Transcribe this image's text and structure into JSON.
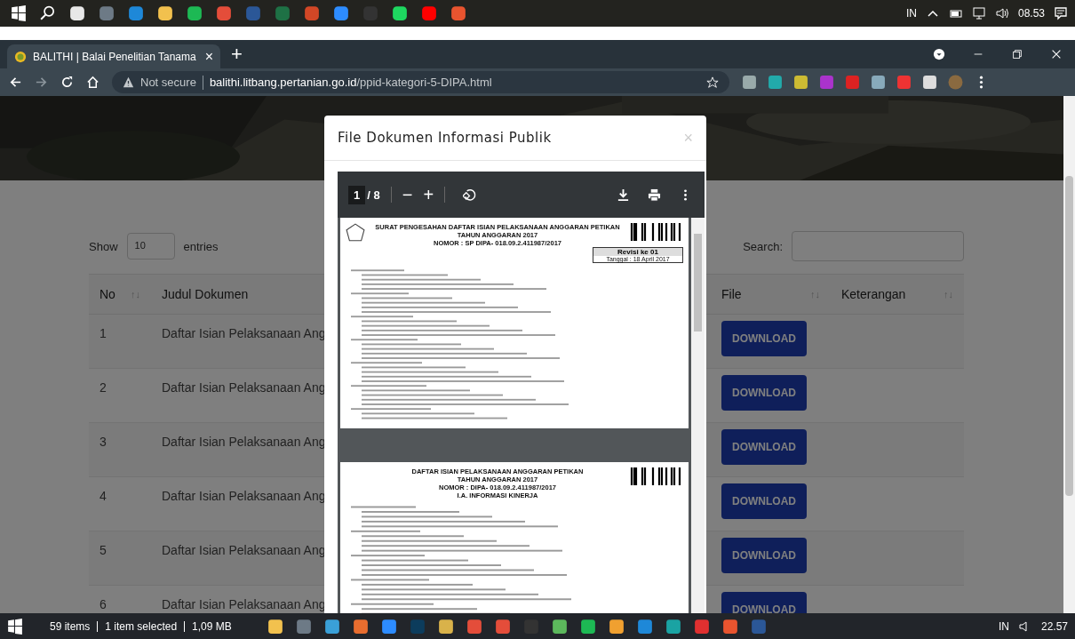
{
  "taskbar_top": {
    "language": "IN",
    "time": "08.53"
  },
  "browser": {
    "tab": {
      "title": "BALITHI | Balai Penelitian Tanama",
      "close": "×",
      "selected": true
    },
    "new_tab": "+",
    "address": {
      "security": "Not secure",
      "domain": "balithi.litbang.pertanian.go.id",
      "path": "/ppid-kategori-5-DIPA.html"
    }
  },
  "page": {
    "show_label": "Show",
    "page_size": "10",
    "entries_label": "entries",
    "search_label": "Search:",
    "columns": [
      {
        "label": "No",
        "sort": "↑↓",
        "kind": "no"
      },
      {
        "label": "Judul Dokumen",
        "kind": "title"
      },
      {
        "label": "File",
        "sort": "↑↓",
        "kind": "file"
      },
      {
        "label": "Keterangan",
        "sort": "↑↓",
        "kind": "note"
      }
    ],
    "rows": [
      {
        "no": "1",
        "title": "Daftar Isian Pelaksanaan Ang",
        "button": "DOWNLOAD"
      },
      {
        "no": "2",
        "title": "Daftar Isian Pelaksanaan Ang",
        "button": "DOWNLOAD"
      },
      {
        "no": "3",
        "title": "Daftar Isian Pelaksanaan Ang",
        "button": "DOWNLOAD"
      },
      {
        "no": "4",
        "title": "Daftar Isian Pelaksanaan Ang",
        "button": "DOWNLOAD"
      },
      {
        "no": "5",
        "title": "Daftar Isian Pelaksanaan Ang",
        "button": "DOWNLOAD"
      },
      {
        "no": "6",
        "title": "Daftar Isian Pelaksanaan Ang",
        "button": "DOWNLOAD"
      }
    ]
  },
  "modal": {
    "title": "File Dokumen Informasi Publik",
    "close": "×",
    "viewer": {
      "page": "1",
      "total": "/ 8",
      "minus": "−",
      "plus": "+",
      "pages": [
        {
          "headings": [
            "SURAT PENGESAHAN DAFTAR ISIAN PELAKSANAAN ANGGARAN PETIKAN",
            "TAHUN ANGGARAN 2017",
            "NOMOR : SP DIPA- 018.09.2.411987/2017"
          ],
          "revision": "Revisi ke 01",
          "date": "Tanggal : 18 April 2017"
        },
        {
          "headings": [
            "DAFTAR ISIAN PELAKSANAAN ANGGARAN PETIKAN",
            "TAHUN ANGGARAN 2017",
            "NOMOR : DIPA- 018.09.2.411987/2017",
            "I.A. INFORMASI KINERJA"
          ]
        }
      ]
    }
  },
  "taskbar_bottom": {
    "status": [
      "59 items",
      "1 item selected",
      "1,09 MB"
    ],
    "language": "IN",
    "time": "22.57"
  }
}
